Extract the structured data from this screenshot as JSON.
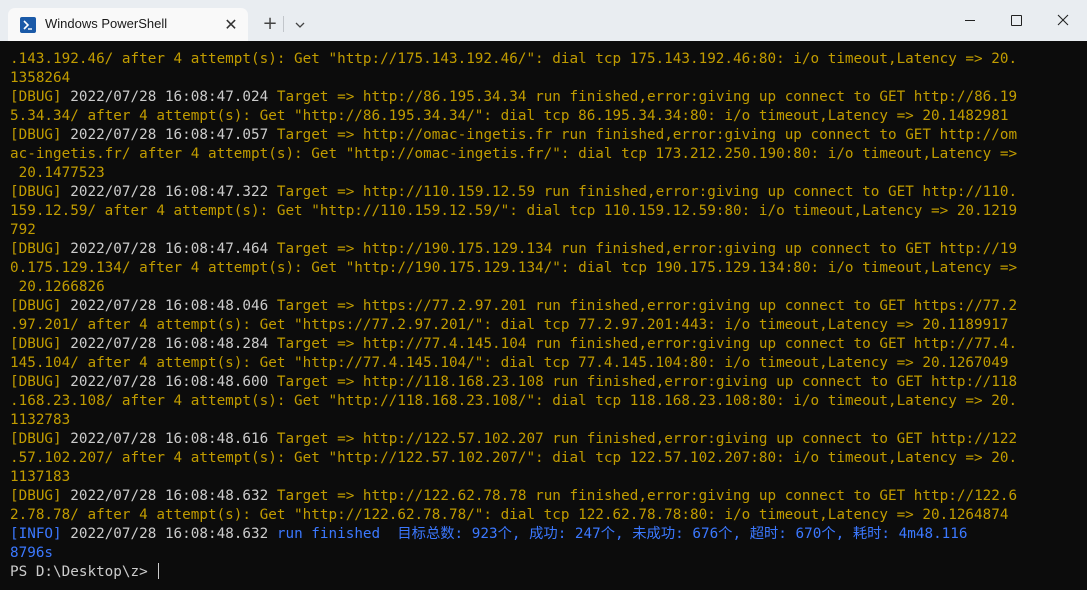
{
  "window": {
    "tab_title": "Windows PowerShell",
    "tab_close": "✕",
    "new_tab": "+",
    "icons": {
      "tab_icon": "powershell-icon",
      "close": "close-icon",
      "new_tab": "plus-icon",
      "dropdown": "chevron-down-icon",
      "minimize": "minimize-icon",
      "maximize": "maximize-icon",
      "window_close": "close-icon"
    }
  },
  "colors": {
    "dbug_text": "#c19c00",
    "info_label": "#3b78ff",
    "info_text": "#61d6d6",
    "timestamp": "#cccccc",
    "background": "#0c0c0c"
  },
  "terminal": {
    "entries": [
      {
        "tag": "",
        "time": "",
        "msg": ".143.192.46/ after 4 attempt(s): Get \"http://175.143.192.46/\": dial tcp 175.143.192.46:80: i/o timeout,Latency => 20.1358264"
      },
      {
        "tag": "[DBUG]",
        "time": "2022/07/28 16:08:47.024",
        "msg": "Target => http://86.195.34.34 run finished,error:giving up connect to GET http://86.195.34.34/ after 4 attempt(s): Get \"http://86.195.34.34/\": dial tcp 86.195.34.34:80: i/o timeout,Latency => 20.1482981"
      },
      {
        "tag": "[DBUG]",
        "time": "2022/07/28 16:08:47.057",
        "msg": "Target => http://omac-ingetis.fr run finished,error:giving up connect to GET http://omac-ingetis.fr/ after 4 attempt(s): Get \"http://omac-ingetis.fr/\": dial tcp 173.212.250.190:80: i/o timeout,Latency => 20.1477523"
      },
      {
        "tag": "[DBUG]",
        "time": "2022/07/28 16:08:47.322",
        "msg": "Target => http://110.159.12.59 run finished,error:giving up connect to GET http://110.159.12.59/ after 4 attempt(s): Get \"http://110.159.12.59/\": dial tcp 110.159.12.59:80: i/o timeout,Latency => 20.1219792"
      },
      {
        "tag": "[DBUG]",
        "time": "2022/07/28 16:08:47.464",
        "msg": "Target => http://190.175.129.134 run finished,error:giving up connect to GET http://190.175.129.134/ after 4 attempt(s): Get \"http://190.175.129.134/\": dial tcp 190.175.129.134:80: i/o timeout,Latency => 20.1266826"
      },
      {
        "tag": "[DBUG]",
        "time": "2022/07/28 16:08:48.046",
        "msg": "Target => https://77.2.97.201 run finished,error:giving up connect to GET https://77.2.97.201/ after 4 attempt(s): Get \"https://77.2.97.201/\": dial tcp 77.2.97.201:443: i/o timeout,Latency => 20.1189917"
      },
      {
        "tag": "[DBUG]",
        "time": "2022/07/28 16:08:48.284",
        "msg": "Target => http://77.4.145.104 run finished,error:giving up connect to GET http://77.4.145.104/ after 4 attempt(s): Get \"http://77.4.145.104/\": dial tcp 77.4.145.104:80: i/o timeout,Latency => 20.1267049"
      },
      {
        "tag": "[DBUG]",
        "time": "2022/07/28 16:08:48.600",
        "msg": "Target => http://118.168.23.108 run finished,error:giving up connect to GET http://118.168.23.108/ after 4 attempt(s): Get \"http://118.168.23.108/\": dial tcp 118.168.23.108:80: i/o timeout,Latency => 20.1132783"
      },
      {
        "tag": "[DBUG]",
        "time": "2022/07/28 16:08:48.616",
        "msg": "Target => http://122.57.102.207 run finished,error:giving up connect to GET http://122.57.102.207/ after 4 attempt(s): Get \"http://122.57.102.207/\": dial tcp 122.57.102.207:80: i/o timeout,Latency => 20.1137183"
      },
      {
        "tag": "[DBUG]",
        "time": "2022/07/28 16:08:48.632",
        "msg": "Target => http://122.62.78.78 run finished,error:giving up connect to GET http://122.62.78.78/ after 4 attempt(s): Get \"http://122.62.78.78/\": dial tcp 122.62.78.78:80: i/o timeout,Latency => 20.1264874"
      }
    ],
    "info": {
      "tag": "[INFO]",
      "time": "2022/07/28 16:08:48.632",
      "label": "run finished",
      "summary": "目标总数: 923个, 成功: 247个, 未成功: 676个, 超时: 670个, 耗时: 4m48.1168796s"
    },
    "prompt": "PS D:\\Desktop\\z> "
  }
}
